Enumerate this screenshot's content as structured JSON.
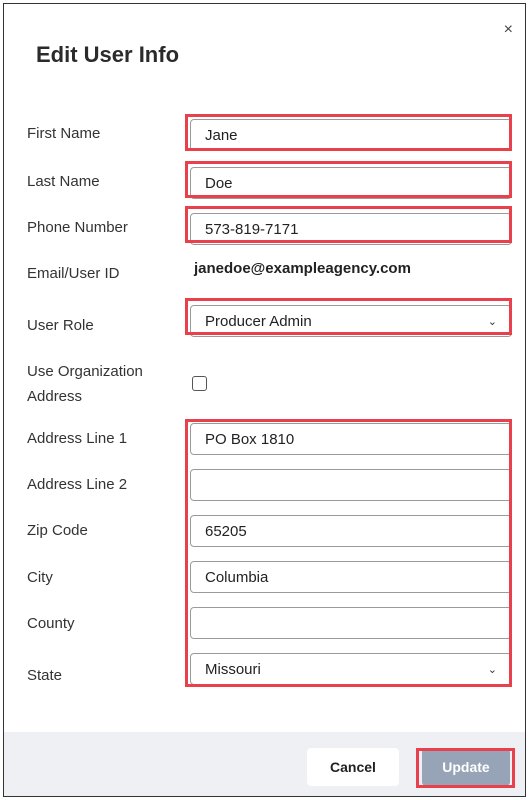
{
  "dialog": {
    "title": "Edit User Info",
    "close_glyph": "×"
  },
  "fields": {
    "first_name": {
      "label": "First Name",
      "value": "Jane"
    },
    "last_name": {
      "label": "Last Name",
      "value": "Doe"
    },
    "phone": {
      "label": "Phone Number",
      "value": "573-819-7171"
    },
    "email": {
      "label": "Email/User ID",
      "value": "janedoe@exampleagency.com"
    },
    "user_role": {
      "label": "User Role",
      "value": "Producer Admin"
    },
    "use_org_address": {
      "label_line1": "Use Organization",
      "label_line2": "Address",
      "checked": false
    },
    "address1": {
      "label": "Address Line 1",
      "value": "PO Box 1810"
    },
    "address2": {
      "label": "Address Line 2",
      "value": ""
    },
    "zip": {
      "label": "Zip Code",
      "value": "65205"
    },
    "city": {
      "label": "City",
      "value": "Columbia"
    },
    "county": {
      "label": "County",
      "value": ""
    },
    "state": {
      "label": "State",
      "value": "Missouri"
    }
  },
  "footer": {
    "cancel_label": "Cancel",
    "update_label": "Update"
  },
  "icons": {
    "chevron": "chevron-down-icon",
    "close": "close-icon"
  },
  "colors": {
    "highlight": "#e8414b",
    "update_button": "#97a3b6",
    "footer_bg": "#eef0f4"
  }
}
